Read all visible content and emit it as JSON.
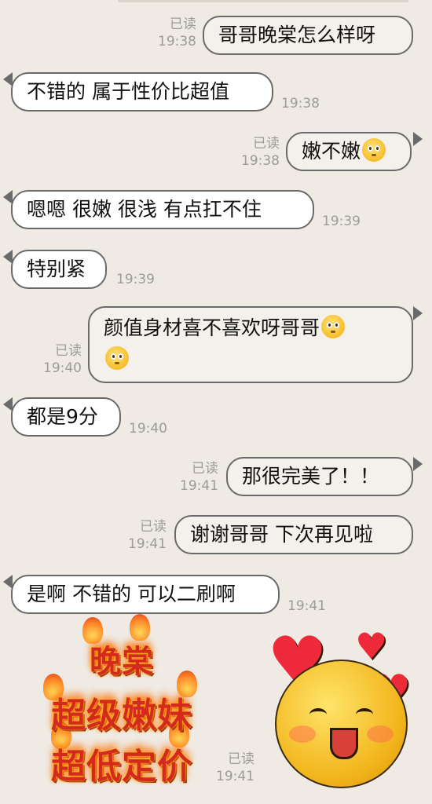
{
  "read_label": "已读",
  "messages": [
    {
      "side": "right",
      "text": "哥哥晚棠怎么样呀",
      "time": "19:38"
    },
    {
      "side": "left",
      "text": "不错的 属于性价比超值",
      "time": "19:38"
    },
    {
      "side": "right",
      "text": "嫩不嫩",
      "time": "19:38",
      "emoji": "pleading-face"
    },
    {
      "side": "left",
      "text": "嗯嗯 很嫩 很浅  有点扛不住",
      "time": "19:39"
    },
    {
      "side": "left",
      "text": "特别紧",
      "time": "19:39"
    },
    {
      "side": "right",
      "text": "颜值身材喜不喜欢呀哥哥",
      "time": "19:40",
      "emoji": "pleading-face"
    },
    {
      "side": "left",
      "text": "都是9分",
      "time": "19:40"
    },
    {
      "side": "right",
      "text": "那很完美了！！",
      "time": "19:41"
    },
    {
      "side": "right",
      "text": "谢谢哥哥 下次再见啦",
      "time": "19:41"
    },
    {
      "side": "left",
      "text": "是啊 不错的 可以二刷啊",
      "time": "19:41"
    }
  ],
  "sticker_left": {
    "lines": [
      "晚棠",
      "超级嫩妹",
      "超低定价"
    ],
    "style": "flaming-red-text"
  },
  "sticker_right": {
    "image": "yellow-blushing-face-with-hearts",
    "time": "19:41"
  }
}
